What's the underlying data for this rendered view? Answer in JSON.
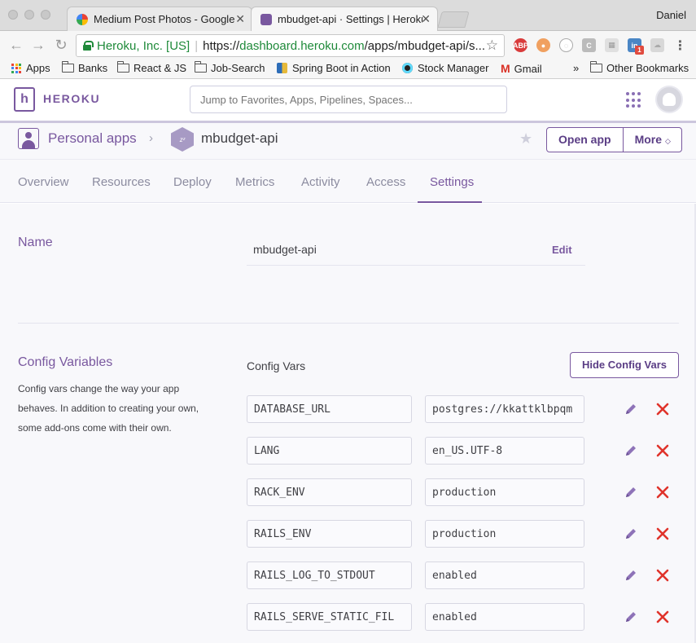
{
  "browser": {
    "tabs": [
      {
        "title": "Medium Post Photos - Google"
      },
      {
        "title": "mbudget-api · Settings | Heroku"
      }
    ],
    "user": "Daniel",
    "omnibox": {
      "secure_label": "Heroku, Inc. [US]",
      "url_scheme": "https://",
      "url_host": "dashboard.heroku.com",
      "url_path": "/apps/mbudget-api/s..."
    },
    "bookmarks": [
      "Apps",
      "Banks",
      "React & JS",
      "Job-Search",
      "Spring Boot in Action",
      "Stock Manager",
      "Gmail"
    ],
    "overflow": "»",
    "other_bookmarks": "Other Bookmarks",
    "ext_badge": "1"
  },
  "header": {
    "brand": "HEROKU",
    "search_placeholder": "Jump to Favorites, Apps, Pipelines, Spaces..."
  },
  "app": {
    "crumb_root": "Personal apps",
    "name": "mbudget-api",
    "open_app": "Open app",
    "more": "More"
  },
  "tabs": [
    "Overview",
    "Resources",
    "Deploy",
    "Metrics",
    "Activity",
    "Access",
    "Settings"
  ],
  "active_tab": "Settings",
  "settings": {
    "name_label": "Name",
    "name_value": "mbudget-api",
    "edit_label": "Edit",
    "config_label": "Config Variables",
    "config_desc": "Config vars change the way your app behaves. In addition to creating your own, some add-ons come with their own.",
    "config_vars_title": "Config Vars",
    "hide_button": "Hide Config Vars",
    "vars": [
      {
        "key": "DATABASE_URL",
        "value": "postgres://kkattklbpqm"
      },
      {
        "key": "LANG",
        "value": "en_US.UTF-8"
      },
      {
        "key": "RACK_ENV",
        "value": "production"
      },
      {
        "key": "RAILS_ENV",
        "value": "production"
      },
      {
        "key": "RAILS_LOG_TO_STDOUT",
        "value": "enabled"
      },
      {
        "key": "RAILS_SERVE_STATIC_FIL",
        "value": "enabled"
      }
    ]
  },
  "colors": {
    "brand_purple": "#79589f",
    "delete_red": "#e0332b",
    "secure_green": "#1f8a3a"
  },
  "icons": {
    "edit": "pencil-icon",
    "delete": "close-x-icon",
    "launcher": "app-launcher-grid-icon",
    "favorite": "star-icon"
  }
}
